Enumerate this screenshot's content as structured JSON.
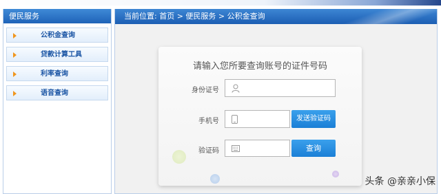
{
  "sidebar": {
    "title": "便民服务",
    "items": [
      {
        "label": "公积金查询"
      },
      {
        "label": "贷款计算工具"
      },
      {
        "label": "利率查询"
      },
      {
        "label": "语音查询"
      }
    ]
  },
  "breadcrumb": {
    "text": "当前位置: 首页 > 便民服务 > 公积金查询"
  },
  "form": {
    "title": "请输入您所要查询账号的证件号码",
    "id_label": "身份证号",
    "id_value": "",
    "phone_label": "手机号",
    "phone_value": "",
    "send_code_button": "发送验证码",
    "code_label": "验证码",
    "code_value": "",
    "query_button": "查询"
  },
  "watermark": "头条 @亲亲小保",
  "colors": {
    "header_blue": "#1f63b8",
    "button_blue": "#2b8fe2",
    "arrow_orange": "#f0961e"
  }
}
